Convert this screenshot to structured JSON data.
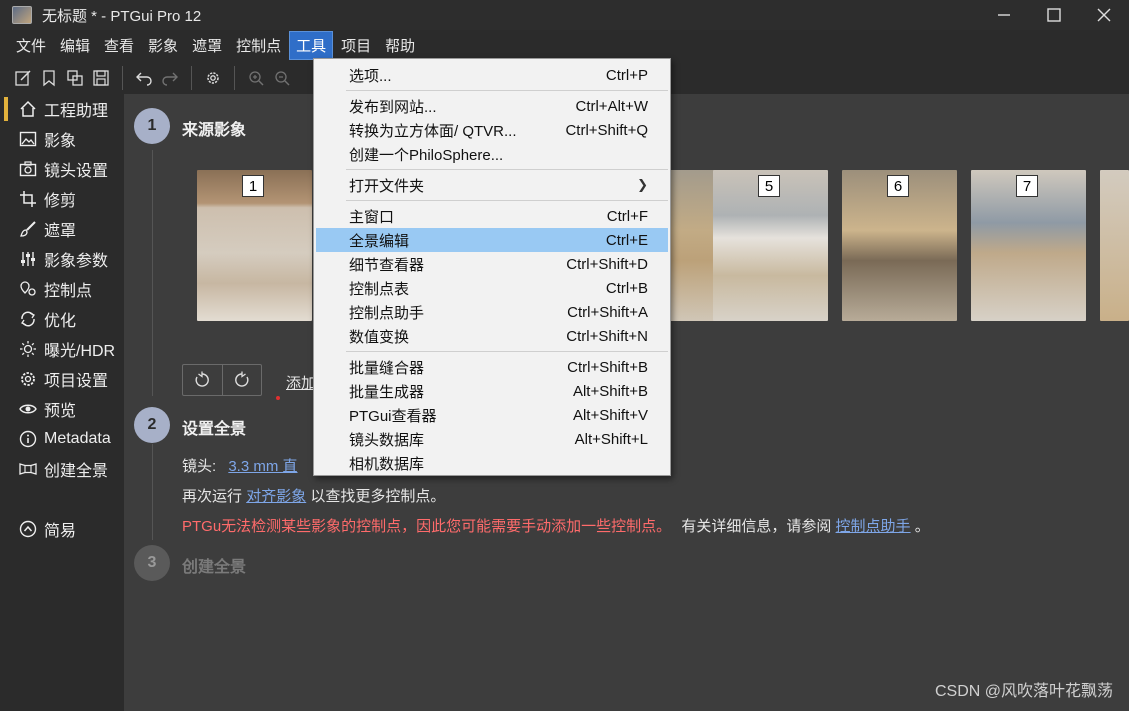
{
  "window": {
    "title": "无标题 * - PTGui Pro 12"
  },
  "menubar": [
    "文件",
    "编辑",
    "查看",
    "影象",
    "遮罩",
    "控制点",
    "工具",
    "项目",
    "帮助"
  ],
  "menubar_active": "工具",
  "toolbar": {
    "icons": [
      "edit-icon",
      "bookmark-icon",
      "copy-icon",
      "save-icon",
      "undo-icon",
      "redo-icon",
      "gear-icon",
      "zoom-in-icon",
      "zoom-out-icon"
    ]
  },
  "sidebar": {
    "items": [
      {
        "label": "工程助理",
        "icon": "home-icon",
        "active": true
      },
      {
        "label": "影象",
        "icon": "image-icon"
      },
      {
        "label": "镜头设置",
        "icon": "camera-icon"
      },
      {
        "label": "修剪",
        "icon": "crop-icon"
      },
      {
        "label": "遮罩",
        "icon": "brush-icon"
      },
      {
        "label": "影象参数",
        "icon": "sliders-icon"
      },
      {
        "label": "控制点",
        "icon": "control-point-icon"
      },
      {
        "label": "优化",
        "icon": "optimize-icon"
      },
      {
        "label": "曝光/HDR",
        "icon": "sun-icon"
      },
      {
        "label": "项目设置",
        "icon": "gear-icon"
      },
      {
        "label": "预览",
        "icon": "eye-icon"
      },
      {
        "label": "Metadata",
        "icon": "info-icon"
      },
      {
        "label": "创建全景",
        "icon": "panorama-icon"
      }
    ],
    "simple": {
      "label": "简易",
      "icon": "chevron-up-circle-icon"
    }
  },
  "steps": [
    {
      "num": "1",
      "title": "来源影象"
    },
    {
      "num": "2",
      "title": "设置全景"
    },
    {
      "num": "3",
      "title": "创建全景"
    }
  ],
  "thumbnails": [
    "1",
    "5",
    "6",
    "7"
  ],
  "source": {
    "add_link": "添加"
  },
  "setup": {
    "lens_label": "镜头:",
    "lens_link": "3.3 mm 直",
    "rerun_prefix": "再次运行",
    "rerun_link": "对齐影象",
    "rerun_suffix": "以查找更多控制点。",
    "warning": "PTGu无法检测某些影象的控制点，因此您可能需要手动添加一些控制点。",
    "info_prefix": "有关详细信息，请参阅",
    "info_link": "控制点助手",
    "info_suffix": "。"
  },
  "dropdown": {
    "groups": [
      [
        {
          "label": "选项...",
          "shortcut": "Ctrl+P"
        }
      ],
      [
        {
          "label": "发布到网站...",
          "shortcut": "Ctrl+Alt+W"
        },
        {
          "label": "转换为立方体面/ QTVR...",
          "shortcut": "Ctrl+Shift+Q"
        },
        {
          "label": "创建一个PhiloSphere...",
          "shortcut": ""
        }
      ],
      [
        {
          "label": "打开文件夹",
          "shortcut": "",
          "submenu": true
        }
      ],
      [
        {
          "label": "主窗口",
          "shortcut": "Ctrl+F"
        },
        {
          "label": "全景编辑",
          "shortcut": "Ctrl+E",
          "highlighted": true
        },
        {
          "label": "细节查看器",
          "shortcut": "Ctrl+Shift+D"
        },
        {
          "label": "控制点表",
          "shortcut": "Ctrl+B"
        },
        {
          "label": "控制点助手",
          "shortcut": "Ctrl+Shift+A"
        },
        {
          "label": "数值变换",
          "shortcut": "Ctrl+Shift+N"
        }
      ],
      [
        {
          "label": "批量缝合器",
          "shortcut": "Ctrl+Shift+B"
        },
        {
          "label": "批量生成器",
          "shortcut": "Alt+Shift+B"
        },
        {
          "label": "PTGui查看器",
          "shortcut": "Alt+Shift+V"
        },
        {
          "label": "镜头数据库",
          "shortcut": "Alt+Shift+L"
        },
        {
          "label": "相机数据库",
          "shortcut": ""
        }
      ]
    ]
  },
  "watermark": "CSDN @风吹落叶花飘荡",
  "colors": {
    "accent": "#2f6ec8",
    "highlight": "#99c9f3",
    "link": "#7ea6e8",
    "warning": "#ff6b6b",
    "active_marker": "#e3b23c"
  }
}
